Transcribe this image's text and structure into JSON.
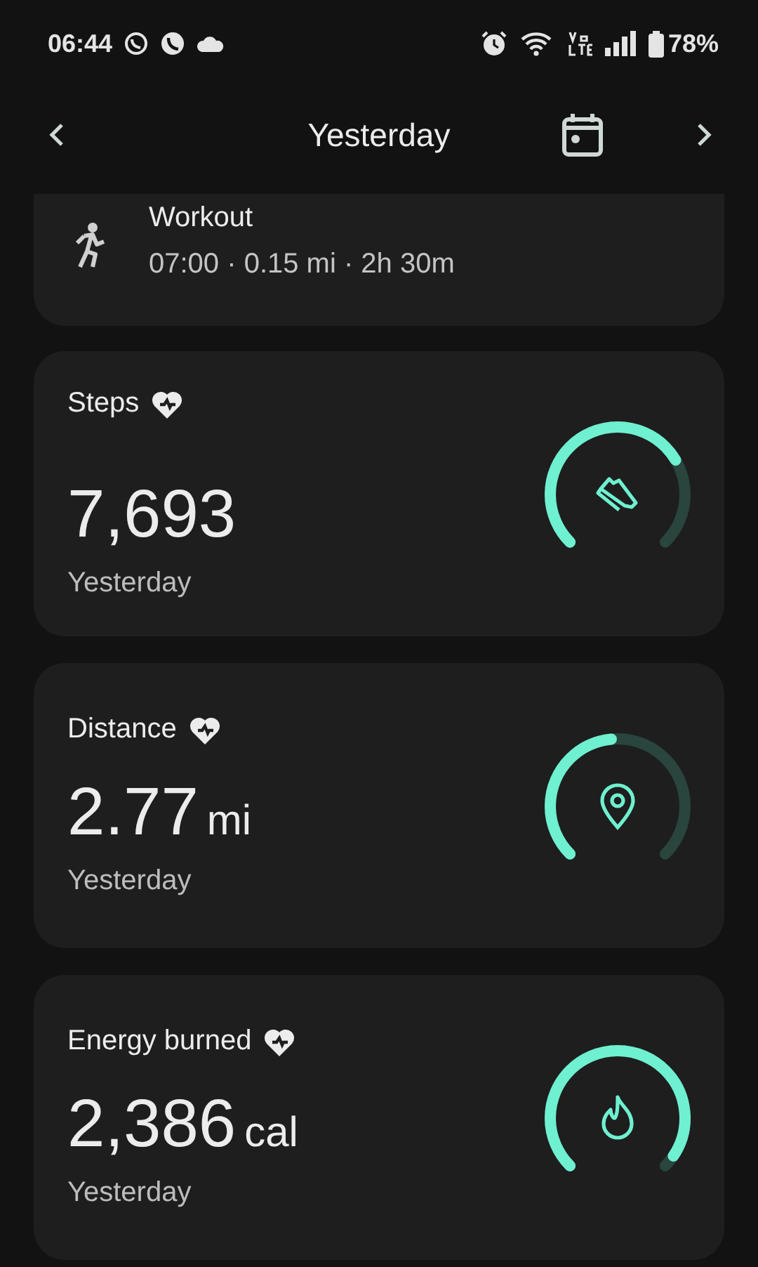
{
  "status_bar": {
    "time": "06:44",
    "battery": "78%"
  },
  "header": {
    "title": "Yesterday"
  },
  "workout": {
    "title": "Workout",
    "details": "07:00 · 0.15 mi · 2h 30m"
  },
  "metrics": [
    {
      "kind": "steps",
      "title": "Steps",
      "value": "7,693",
      "period": "Yesterday",
      "level": 0.72
    },
    {
      "kind": "distance",
      "title": "Distance",
      "value": "2.77",
      "unit": "mi",
      "period": "Yesterday",
      "level": 0.48
    },
    {
      "kind": "energy",
      "title": "Energy burned",
      "value": "2,386",
      "unit": "cal",
      "period": "Yesterday",
      "level": 0.96
    }
  ]
}
